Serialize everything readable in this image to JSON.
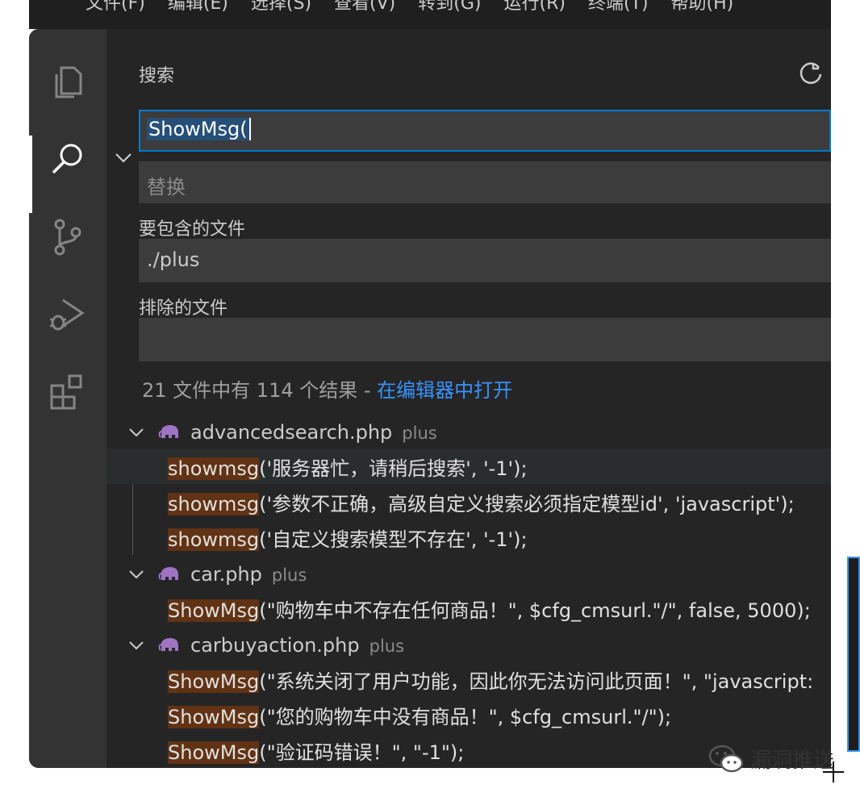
{
  "menubar_peek": [
    "文件(F)",
    "编辑(E)",
    "选择(S)",
    "查看(V)",
    "转到(G)",
    "运行(R)",
    "终端(T)",
    "帮助(H)"
  ],
  "activity_bar": {
    "items": [
      {
        "name": "explorer-icon"
      },
      {
        "name": "search-icon",
        "active": true
      },
      {
        "name": "source-control-icon"
      },
      {
        "name": "run-debug-icon"
      },
      {
        "name": "extensions-icon"
      }
    ]
  },
  "panel": {
    "title": "搜索",
    "search_value": "ShowMsg(",
    "replace_placeholder": "替换",
    "include_label": "要包含的文件",
    "include_value": "./plus",
    "exclude_label": "排除的文件",
    "exclude_value": ""
  },
  "summary": {
    "text": "21 文件中有 114 个结果 - ",
    "link": "在编辑器中打开"
  },
  "results": {
    "files": [
      {
        "name": "advancedsearch.php",
        "dir": "plus",
        "matches": [
          {
            "hit": "showmsg",
            "rest": "('服务器忙，请稍后搜索', '-1');"
          },
          {
            "hit": "showmsg",
            "rest": "('参数不正确，高级自定义搜索必须指定模型id', 'javascript');"
          },
          {
            "hit": "showmsg",
            "rest": "('自定义搜索模型不存在', '-1');"
          }
        ]
      },
      {
        "name": "car.php",
        "dir": "plus",
        "matches": [
          {
            "hit": "ShowMsg",
            "rest": "(\"购物车中不存在任何商品！\", $cfg_cmsurl.\"/\", false, 5000);"
          }
        ]
      },
      {
        "name": "carbuyaction.php",
        "dir": "plus",
        "matches": [
          {
            "hit": "ShowMsg",
            "rest": "(\"系统关闭了用户功能，因此你无法访问此页面！\", \"javascript:"
          },
          {
            "hit": "ShowMsg",
            "rest": "(\"您的购物车中没有商品！\", $cfg_cmsurl.\"/\");"
          },
          {
            "hit": "ShowMsg",
            "rest": "(\"验证码错误！\", \"-1\");"
          }
        ]
      }
    ]
  },
  "watermark": {
    "text": "漏洞推送",
    "icon": "wechat-icon"
  },
  "colors": {
    "accent": "#007acc",
    "link": "#3794ff",
    "match_highlight": "#613214",
    "sidebar_bg": "#252526",
    "activity_bg": "#333333"
  }
}
